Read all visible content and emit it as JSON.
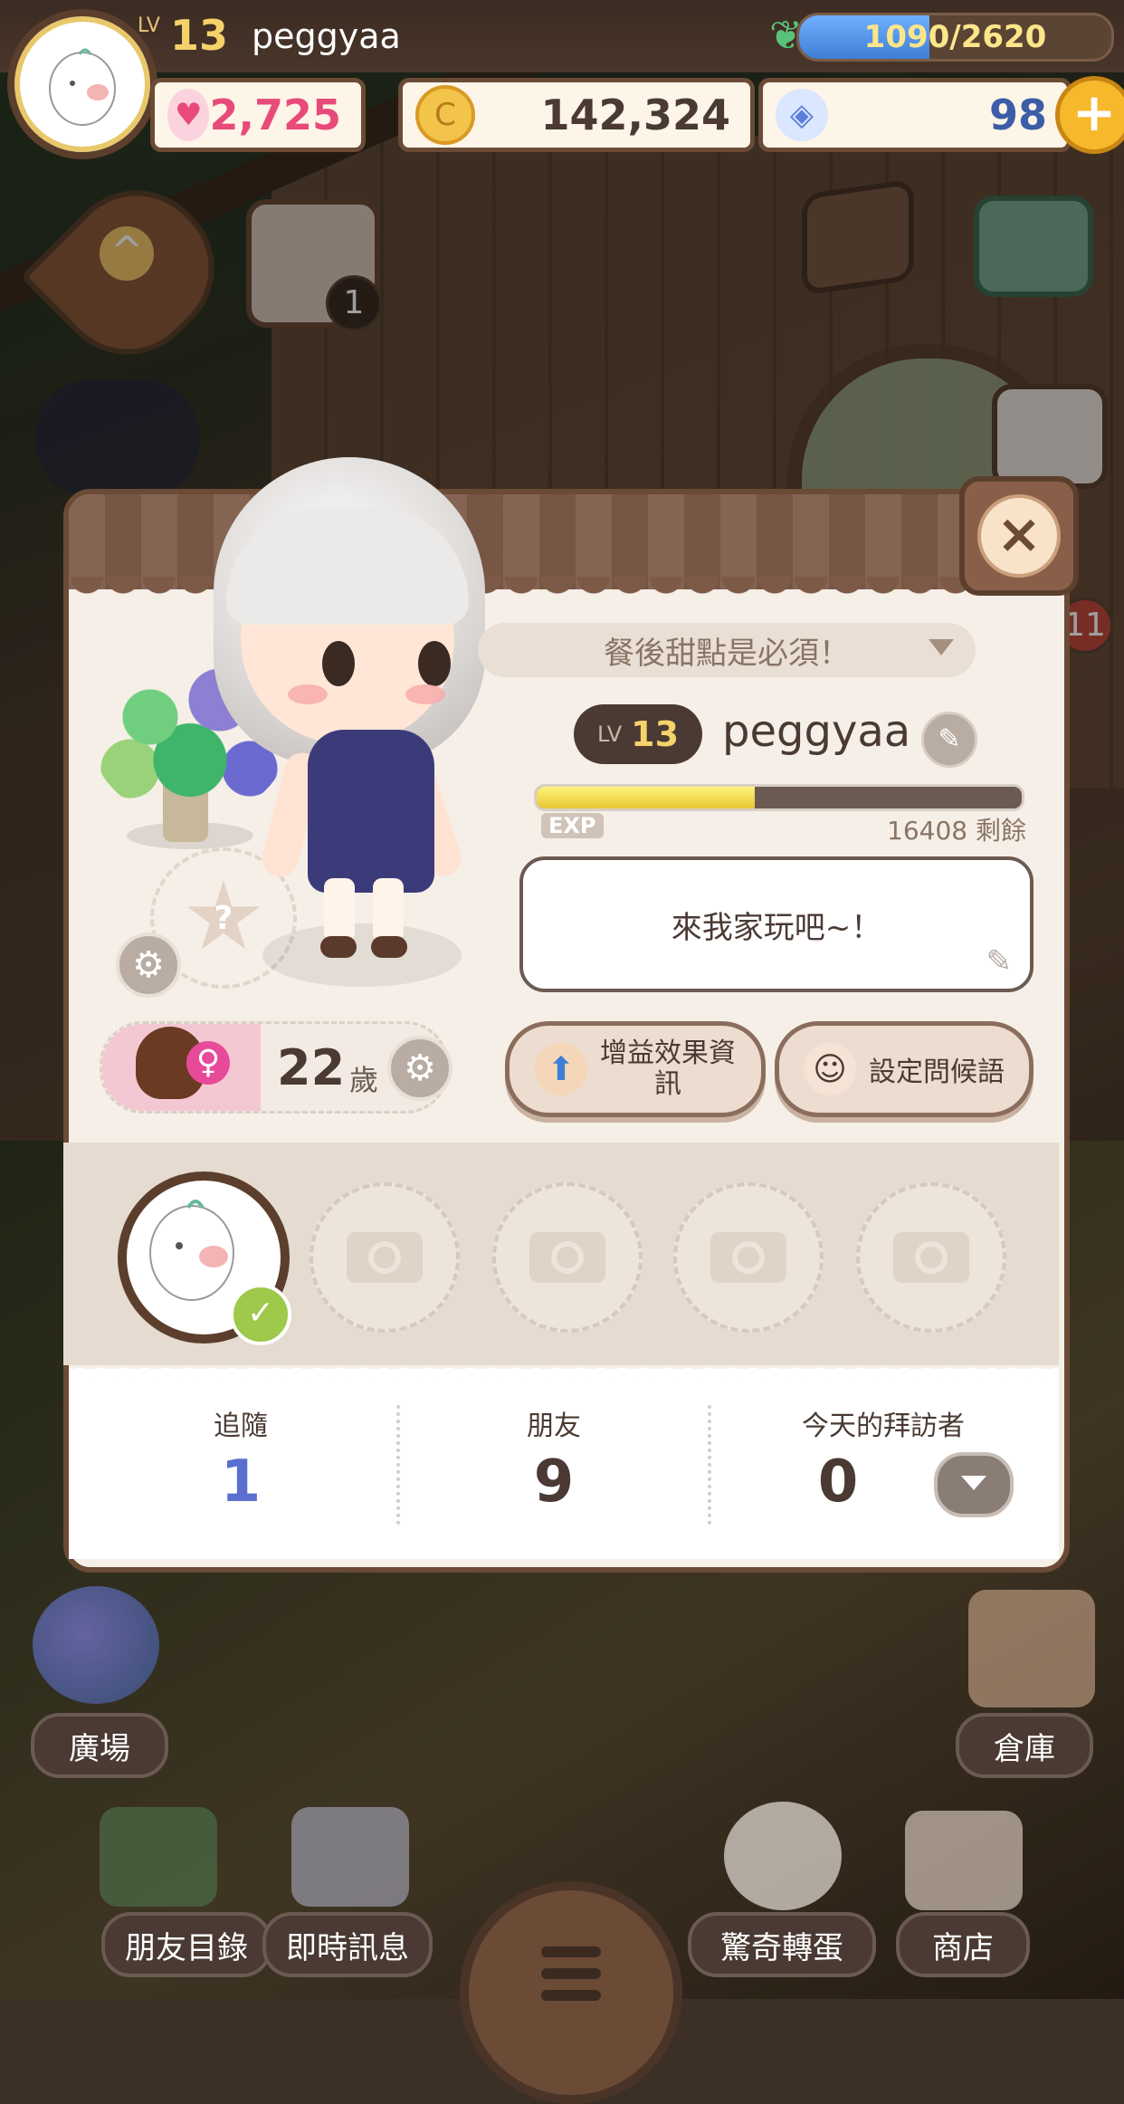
{
  "hud": {
    "level_prefix": "LV",
    "level": "13",
    "username": "peggyaa",
    "exp_text": "1090/2620",
    "exp_fraction": 0.416,
    "hearts": "2,725",
    "coins": "142,324",
    "gems": "98",
    "plus": "+",
    "calendar_badge": "1",
    "side_badge": "11"
  },
  "profile": {
    "mood": "餐後甜點是必須！",
    "level_prefix": "LV",
    "level": "13",
    "name": "peggyaa",
    "exp_label": "EXP",
    "exp_fraction": 0.45,
    "exp_remaining": "16408",
    "exp_remaining_suffix": "剩餘",
    "greeting": "來我家玩吧~！",
    "buff_button": "增益效果資訊",
    "greeting_button": "設定問候語",
    "age": "22",
    "age_unit": "歲",
    "slot_question": "?",
    "close": "×"
  },
  "stats": {
    "follow_label": "追隨",
    "follow_value": "1",
    "friends_label": "朋友",
    "friends_value": "9",
    "visitors_label": "今天的拜訪者",
    "visitors_value": "0"
  },
  "nav": {
    "plaza": "廣場",
    "warehouse": "倉庫",
    "friends_list": "朋友目錄",
    "instant_message": "即時訊息",
    "gacha": "驚奇轉蛋",
    "shop": "商店"
  },
  "colors": {
    "follow_value": "#5b6fd0",
    "heart": "#e84a7a",
    "coin": "#e9a72a",
    "gem": "#5a7fd8"
  },
  "icons": [
    "heart-icon",
    "coin-icon",
    "gem-icon",
    "leaf-icon",
    "calendar-icon",
    "close-icon",
    "pencil-icon",
    "gear-icon",
    "camera-icon",
    "check-icon",
    "chevron-down-icon",
    "menu-icon"
  ]
}
